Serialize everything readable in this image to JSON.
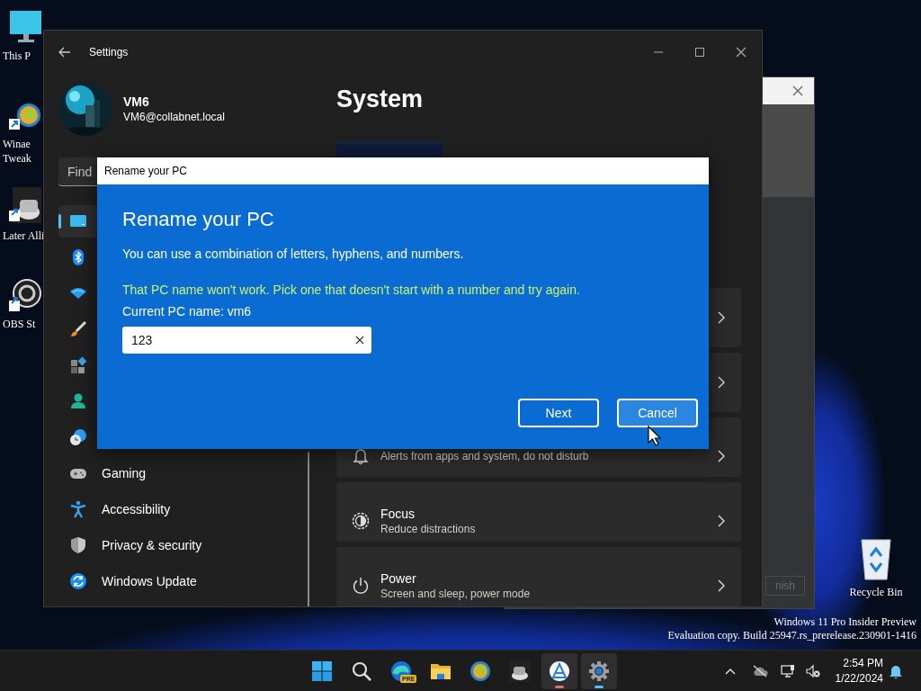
{
  "desktop": {
    "icons": [
      {
        "kind": "monitor",
        "lines": [
          "This P"
        ]
      },
      {
        "kind": "tweaker",
        "lines": [
          "Winae",
          "Tweak"
        ]
      },
      {
        "kind": "alligator",
        "lines": [
          "Later Alli"
        ]
      },
      {
        "kind": "obs",
        "lines": [
          "OBS St"
        ]
      }
    ],
    "recycle_bin": {
      "label": "Recycle Bin"
    }
  },
  "background_window": {
    "button": "nish"
  },
  "settings": {
    "title": "Settings",
    "profile": {
      "name": "VM6",
      "email": "VM6@collabnet.local"
    },
    "search": {
      "placeholder": "Find"
    },
    "nav": [
      {
        "kind": "system",
        "selected": true
      },
      {
        "kind": "bluetooth",
        "selected": false
      },
      {
        "kind": "network",
        "selected": false
      },
      {
        "kind": "personalization",
        "selected": false
      },
      {
        "kind": "apps",
        "selected": false
      },
      {
        "kind": "accounts",
        "selected": false
      },
      {
        "kind": "time",
        "selected": false
      },
      {
        "kind": "gaming",
        "label": "Gaming",
        "selected": false
      },
      {
        "kind": "accessibility",
        "label": "Accessibility",
        "selected": false
      },
      {
        "kind": "privacy",
        "label": "Privacy & security",
        "selected": false
      },
      {
        "kind": "update",
        "label": "Windows Update",
        "selected": false
      }
    ],
    "heading": "System",
    "cards": [
      {
        "kind": "covered"
      },
      {
        "kind": "covered"
      },
      {
        "kind": "notifications",
        "subtitle": "Alerts from apps and system, do not disturb"
      },
      {
        "kind": "focus",
        "title": "Focus",
        "subtitle": "Reduce distractions"
      },
      {
        "kind": "power",
        "title": "Power",
        "subtitle": "Screen and sleep, power mode"
      }
    ]
  },
  "dialog": {
    "title": "Rename your PC",
    "heading": "Rename your PC",
    "description": "You can use a combination of letters, hyphens, and numbers.",
    "error": "That PC name won't work. Pick one that doesn't start with a number and try again.",
    "current_name": "Current PC name: vm6",
    "input": {
      "value": "123"
    },
    "buttons": [
      {
        "label": "Next",
        "focused": false
      },
      {
        "label": "Cancel",
        "focused": true
      }
    ]
  },
  "watermark": [
    "Windows 11 Pro Insider Preview",
    "Evaluation copy. Build 25947.rs_prerelease.230901-1416"
  ],
  "taskbar": {
    "apps": [
      {
        "kind": "start",
        "selected": false
      },
      {
        "kind": "search",
        "selected": false
      },
      {
        "kind": "edge",
        "badge": "PRE",
        "selected": false
      },
      {
        "kind": "folder",
        "selected": false
      },
      {
        "kind": "tweaker",
        "selected": false
      },
      {
        "kind": "alligator",
        "selected": false
      },
      {
        "kind": "store",
        "selected": true,
        "color": "#e0707a"
      },
      {
        "kind": "settings",
        "selected": true,
        "color": "#4cc2ff"
      }
    ],
    "tray": {
      "time": "2:54 PM",
      "date": "1/22/2024"
    }
  }
}
